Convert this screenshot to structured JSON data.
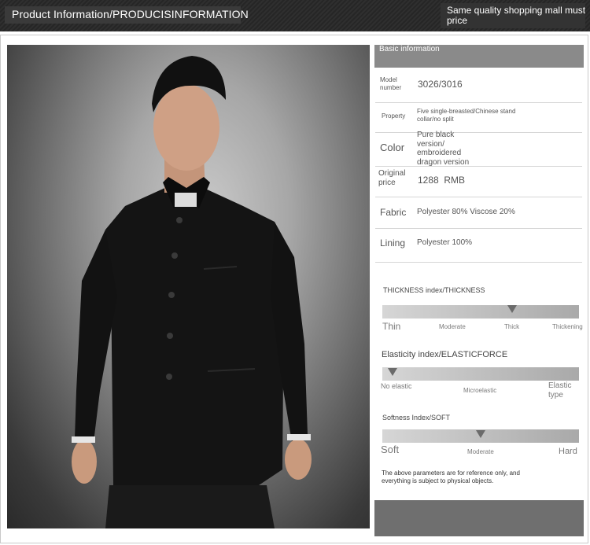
{
  "banner": {
    "title": "Product Information/PRODUCISINFORMATION",
    "right_text": "Same quality shopping mall must price"
  },
  "basic": {
    "header": "Basic information",
    "rows": [
      {
        "label": "Model number",
        "value": "3026/3016"
      },
      {
        "label": "Property",
        "value": "Five single-breasted/Chinese stand collar/no split"
      },
      {
        "label": "Color",
        "value": "Pure black version/ embroidered dragon version"
      },
      {
        "label": "Original price",
        "value": "1288  RMB"
      },
      {
        "label": "Fabric",
        "value": "Polyester 80% Viscose 20%"
      },
      {
        "label": "Lining",
        "value": "Polyester 100%"
      }
    ]
  },
  "thickness": {
    "title": "THICKNESS index/THICKNESS",
    "level_fraction": 0.66,
    "scale": [
      "Thin",
      "Moderate",
      "Thick",
      "Thickening"
    ]
  },
  "elasticity": {
    "title": "Elasticity index/ELASTICFORCE",
    "level_fraction": 0.05,
    "scale": [
      "No elastic",
      "Microelastic",
      "Elastic type"
    ]
  },
  "softness": {
    "title": "Softness Index/SOFT",
    "level_fraction": 0.5,
    "scale": [
      "Soft",
      "Moderate",
      "Hard"
    ]
  },
  "note": "The above parameters are for reference only, and everything is subject to physical objects.",
  "photo": {
    "icon": "model-photo"
  }
}
